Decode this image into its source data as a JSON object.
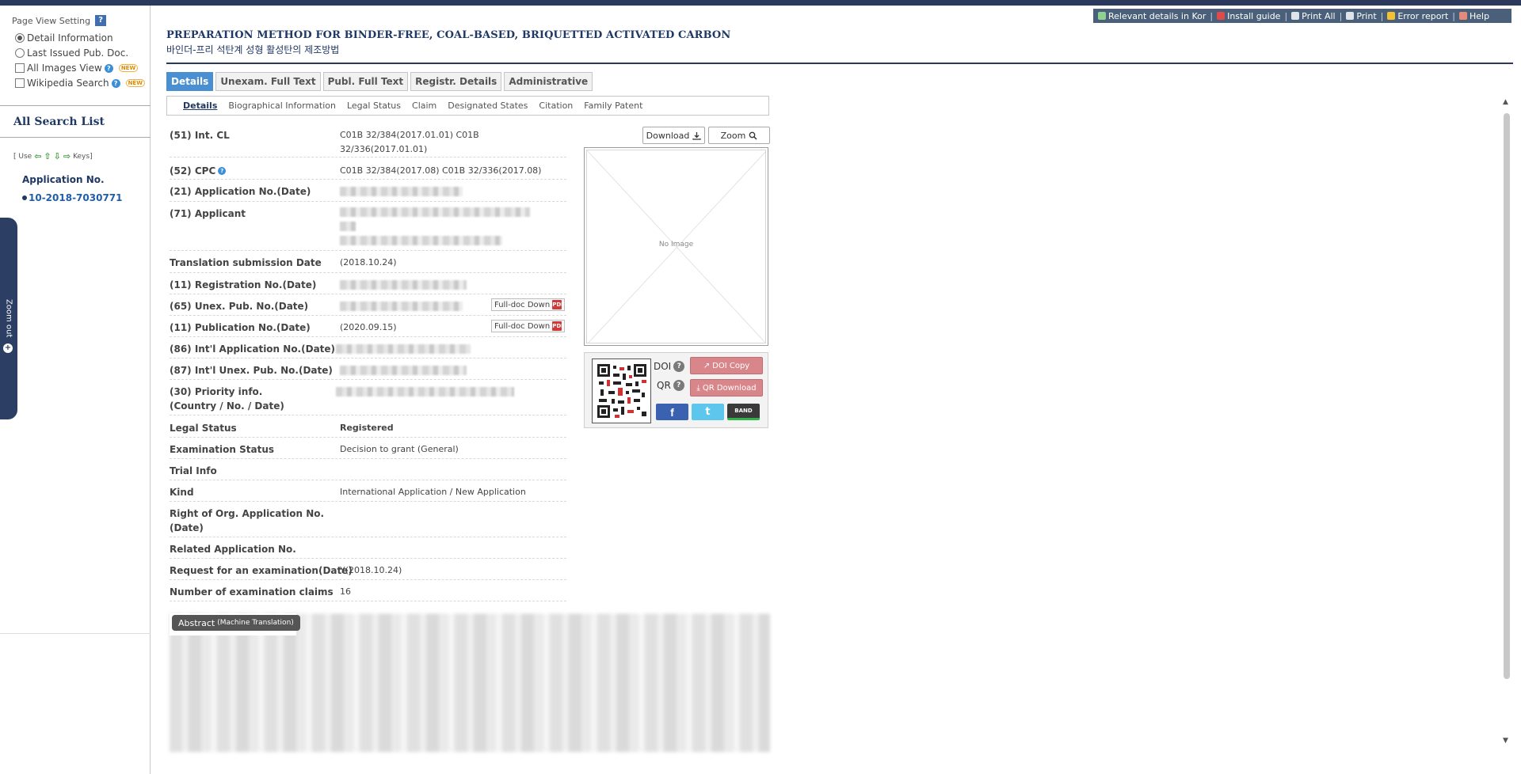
{
  "page_view": {
    "title": "Page View Setting",
    "help": "?",
    "options": [
      {
        "label": "Detail Information",
        "type": "radio",
        "checked": true
      },
      {
        "label": "Last Issued Pub. Doc.",
        "type": "radio",
        "checked": false
      },
      {
        "label": "All Images View",
        "type": "checkbox",
        "checked": false,
        "help": "?",
        "badge": "NEW"
      },
      {
        "label": "Wikipedia Search",
        "type": "checkbox",
        "checked": false,
        "help": "?",
        "badge": "NEW"
      }
    ]
  },
  "search_list": {
    "title": "All Search List",
    "keys_prefix": "[ Use",
    "keys_suffix": "Keys]",
    "arrows": [
      "⇦",
      "⇧",
      "⇩",
      "⇨"
    ],
    "app_label": "Application No.",
    "app_number": "10-2018-7030771"
  },
  "zoom_out": {
    "label": "Zoom out",
    "plus": "+"
  },
  "toolbar": {
    "items": [
      "Relevant details in Kor",
      "Install guide",
      "Print All",
      "Print",
      "Error report",
      "Help"
    ],
    "separator": "|"
  },
  "title": {
    "en": "PREPARATION METHOD FOR BINDER-FREE, COAL-BASED, BRIQUETTED ACTIVATED CARBON",
    "ko": "바인더-프리 석탄계 성형 활성탄의 제조방법"
  },
  "tabs": [
    "Details",
    "Unexam. Full Text",
    "Publ. Full Text",
    "Registr. Details",
    "Administrative"
  ],
  "subtabs": [
    "Details",
    "Biographical Information",
    "Legal Status",
    "Claim",
    "Designated States",
    "Citation",
    "Family Patent"
  ],
  "details": [
    {
      "label": "(51) Int. CL",
      "value": "C01B 32/384(2017.01.01) C01B\n32/336(2017.01.01)"
    },
    {
      "label": "(52) CPC",
      "value": "C01B 32/384(2017.08) C01B 32/336(2017.08)",
      "help": "?"
    },
    {
      "label": "(21) Application No.(Date)",
      "value": ""
    },
    {
      "label": "(71) Applicant",
      "value": ""
    },
    {
      "label": "Translation submission Date",
      "value": "(2018.10.24)"
    },
    {
      "label": "(11) Registration No.(Date)",
      "value": ""
    },
    {
      "label": "(65) Unex. Pub. No.(Date)",
      "value": "",
      "pdf": "Full-doc Down"
    },
    {
      "label": "(11) Publication No.(Date)",
      "value": "(2020.09.15)",
      "pdf": "Full-doc Down"
    },
    {
      "label": "(86) Int'l Application No.(Date)",
      "value": ""
    },
    {
      "label": "(87) Int'l Unex. Pub. No.(Date)",
      "value": ""
    },
    {
      "label": "(30) Priority info.\n(Country / No. / Date)",
      "value": ""
    },
    {
      "label": "Legal Status",
      "value": "Registered"
    },
    {
      "label": "Examination Status",
      "value": "Decision to grant (General)"
    },
    {
      "label": "Trial Info",
      "value": ""
    },
    {
      "label": "Kind",
      "value": "International Application / New Application"
    },
    {
      "label": "Right of Org. Application No.\n(Date)",
      "value": ""
    },
    {
      "label": "Related Application No.",
      "value": ""
    },
    {
      "label": "Request for an examination(Date)",
      "value": "Y(2018.10.24)"
    },
    {
      "label": "Number of examination claims",
      "value": "16"
    }
  ],
  "pdf_icon": "PDF",
  "image_panel": {
    "download": "Download",
    "zoom": "Zoom",
    "no_image": "No Image"
  },
  "qr_panel": {
    "doi_label": "DOI",
    "qr_label": "QR",
    "help": "?",
    "doi_copy": "DOI Copy",
    "qr_download": "QR Download",
    "sns": [
      "f",
      "t",
      "BAND"
    ]
  },
  "abstract": {
    "label": "Abstract",
    "sub": "(Machine Translation)"
  },
  "colors": {
    "navy": "#1f3864",
    "tab_active": "#4a8fd2",
    "toolbar": "#4a607a",
    "pink": "#d9868b"
  }
}
